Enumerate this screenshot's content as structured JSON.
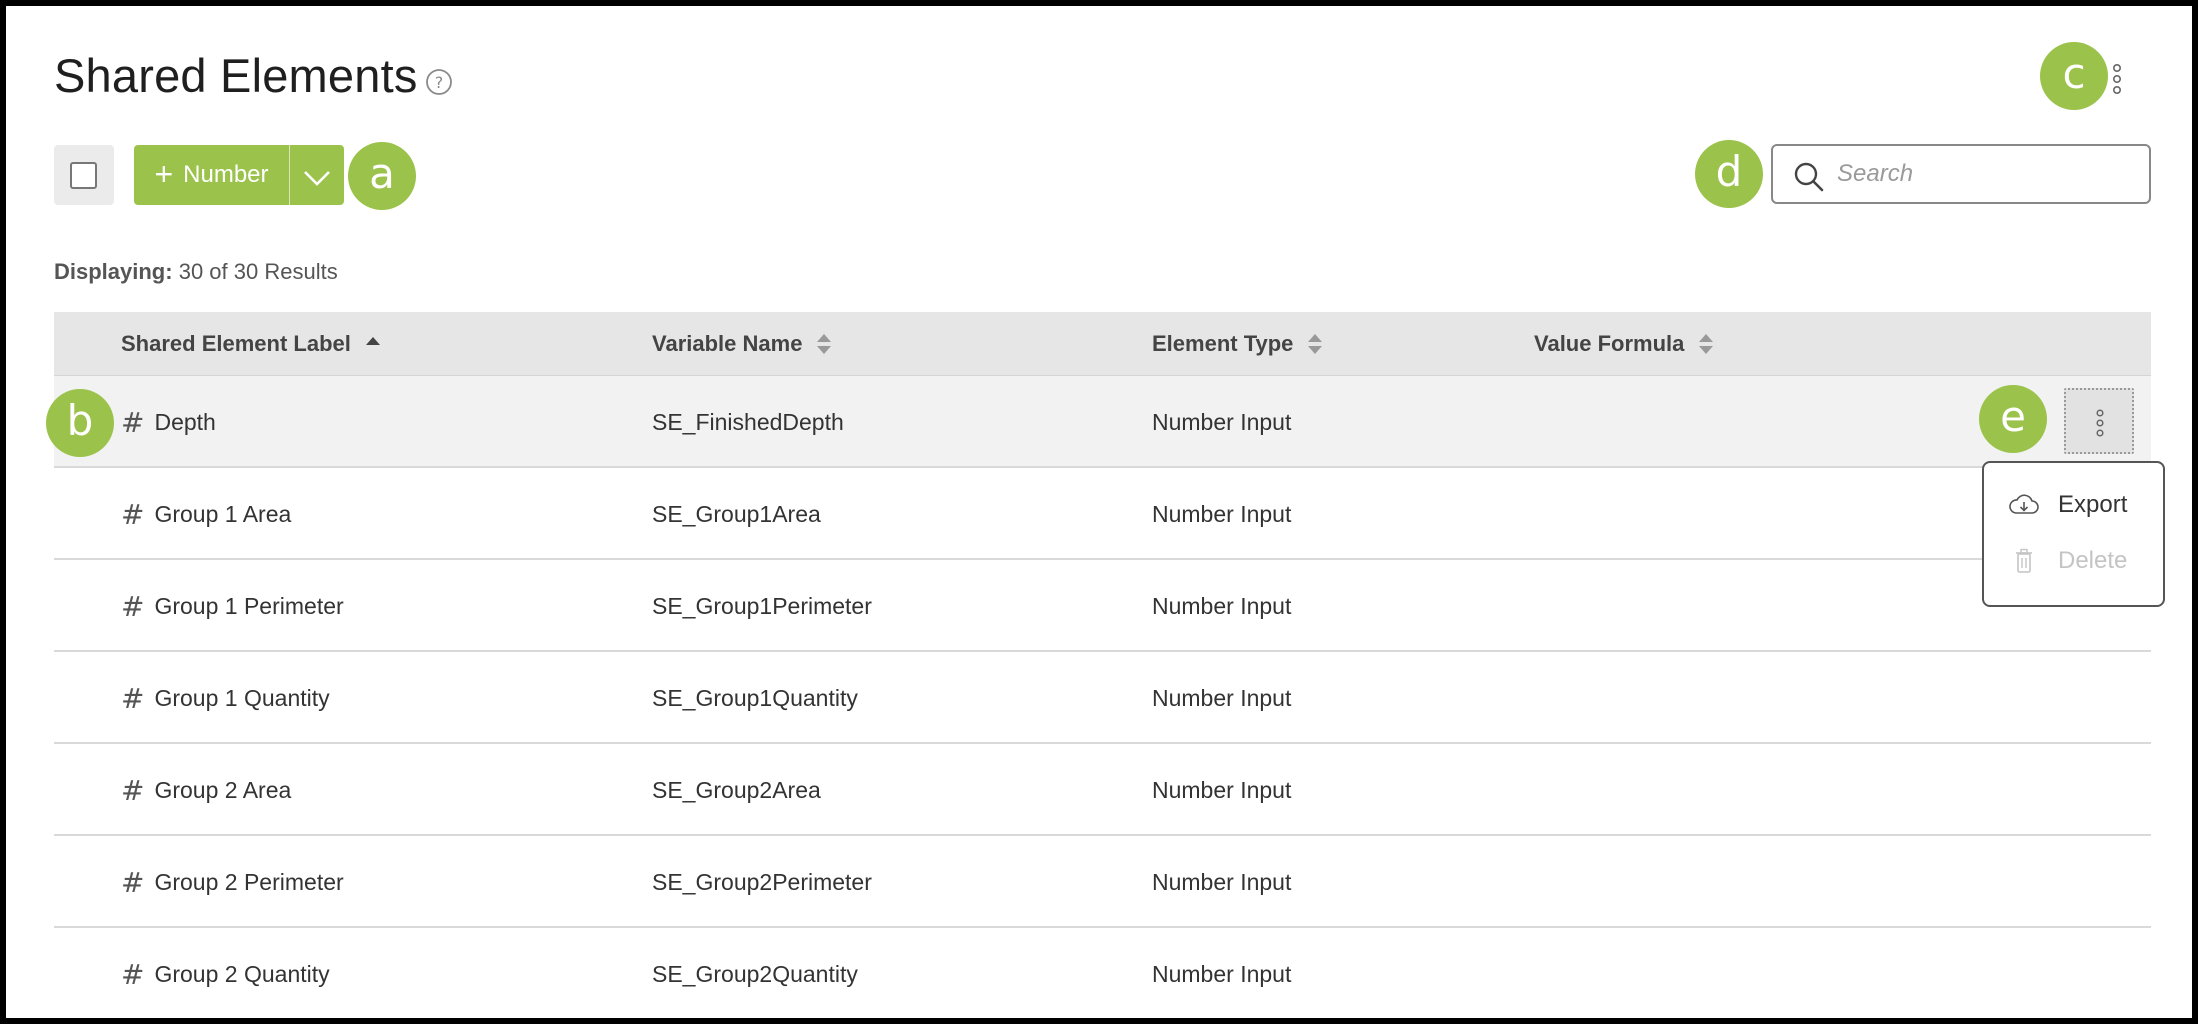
{
  "page": {
    "title": "Shared Elements"
  },
  "toolbar": {
    "add_label": "Number",
    "search_placeholder": "Search"
  },
  "results": {
    "label": "Displaying:",
    "text": "30 of 30 Results"
  },
  "table": {
    "columns": [
      {
        "label": "Shared Element Label",
        "sort": "ascending"
      },
      {
        "label": "Variable Name",
        "sort": "none"
      },
      {
        "label": "Element Type",
        "sort": "none"
      },
      {
        "label": "Value Formula",
        "sort": "none"
      }
    ],
    "rows": [
      {
        "label": "Depth",
        "variable": "SE_FinishedDepth",
        "type": "Number Input",
        "formula": ""
      },
      {
        "label": "Group 1 Area",
        "variable": "SE_Group1Area",
        "type": "Number Input",
        "formula": ""
      },
      {
        "label": "Group 1 Perimeter",
        "variable": "SE_Group1Perimeter",
        "type": "Number Input",
        "formula": ""
      },
      {
        "label": "Group 1 Quantity",
        "variable": "SE_Group1Quantity",
        "type": "Number Input",
        "formula": ""
      },
      {
        "label": "Group 2 Area",
        "variable": "SE_Group2Area",
        "type": "Number Input",
        "formula": ""
      },
      {
        "label": "Group 2 Perimeter",
        "variable": "SE_Group2Perimeter",
        "type": "Number Input",
        "formula": ""
      },
      {
        "label": "Group 2 Quantity",
        "variable": "SE_Group2Quantity",
        "type": "Number Input",
        "formula": ""
      }
    ]
  },
  "row_menu": {
    "items": [
      {
        "label": "Export",
        "icon": "cloud-download-icon",
        "enabled": true
      },
      {
        "label": "Delete",
        "icon": "trash-icon",
        "enabled": false
      }
    ]
  },
  "callouts": {
    "a": "a",
    "b": "b",
    "c": "c",
    "d": "d",
    "e": "e"
  },
  "colors": {
    "accent": "#9bc34b",
    "header_bg": "#e6e6e6",
    "hover_row_bg": "#f2f2f2"
  }
}
